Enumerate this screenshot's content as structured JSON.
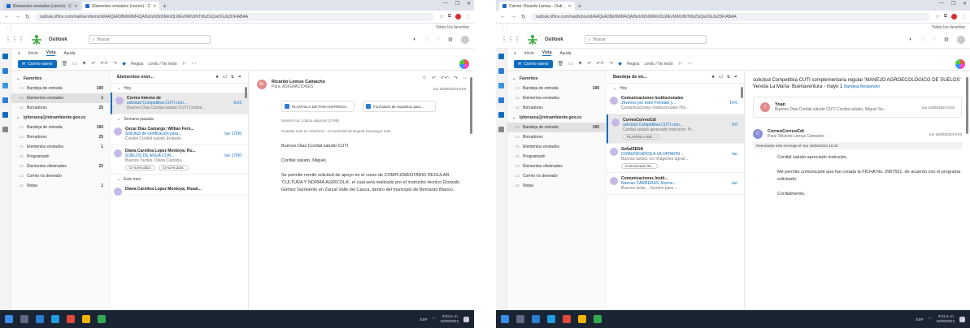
{
  "left": {
    "browser": {
      "tabs": [
        "Elementos enviados (correo) - C",
        "Elementos enviados (correo) - C"
      ],
      "url": "outlook.office.com/mail/sentitems/id/AAQkADBkNWM4ZjAtNzIxNS00MmI3LWEzNWUtNTMxZGQwOGJkZDFiABAA",
      "bookmark_right": "Todos los favoritos"
    },
    "app_name": "Outlook",
    "search_placeholder": "Buscar",
    "ribbon_tabs": [
      "Inicio",
      "Vista",
      "Ayuda"
    ],
    "new_mail_label": "Correo nuevo",
    "ribbon_extra": [
      "Reglas",
      "Leído / No leído"
    ],
    "folders": [
      {
        "name": "Favoritos",
        "count": "",
        "type": "header"
      },
      {
        "name": "Bandeja de entrada",
        "count": "190",
        "type": "item"
      },
      {
        "name": "Elementos enviados",
        "count": "1",
        "type": "item",
        "selected": true
      },
      {
        "name": "Borradores",
        "count": "25",
        "type": "item"
      },
      {
        "name": "lpfonseca@minambiente.gov.co",
        "count": "",
        "type": "header"
      },
      {
        "name": "Bandeja de entrada",
        "count": "190",
        "type": "item"
      },
      {
        "name": "Borradores",
        "count": "25",
        "type": "item"
      },
      {
        "name": "Elementos enviados",
        "count": "1",
        "type": "item"
      },
      {
        "name": "Programado",
        "count": "",
        "type": "item"
      },
      {
        "name": "Elementos eliminados",
        "count": "22",
        "type": "item"
      },
      {
        "name": "Correo no deseado",
        "count": "",
        "type": "item"
      },
      {
        "name": "Notas",
        "count": "1",
        "type": "item"
      }
    ],
    "list_title": "Elementos envi...",
    "groups": [
      "Hoy",
      "Semana pasada",
      "Este mes"
    ],
    "messages": [
      {
        "from": "Correo Interno de",
        "subject": "solicitud Competitiva CUTI com...",
        "time": "9:03",
        "preview": "Buenos Días Cordial saludo CUTI Cordial...",
        "selected": true
      },
      {
        "from": "Oscar Dias Camargo; Willian Fern...",
        "subject": "Solicitud de certificación para...",
        "time": "lun 17/06",
        "preview": "Cordial Cordial saludo Enviado",
        "selected": false
      },
      {
        "from": "Diana Carolina Lopez Montoya; Ru...",
        "subject": "SUELOS DE AGUA CON...",
        "time": "lun 17/06",
        "preview": "Buenos Tardes, Diana Carolina...",
        "selected": false,
        "chips": [
          "CI-sol-8.ddoc",
          "CI-sol-8.ddoc"
        ]
      },
      {
        "from": "Diana Carolina Lopez Montoya; Rosal...",
        "subject": "",
        "time": "",
        "preview": "",
        "selected": false
      }
    ],
    "reading": {
      "from": "Ricardo Lemus Camacho",
      "to": "Para: ASIGNACIONES",
      "date": "lun 18/06/2024 9:03",
      "attachments": [
        "PLANTILLA DE PARA ENTREGA...",
        "Formulario de requisitos para..."
      ],
      "note": "Mostrar los 2 datos adjuntos (2 MB)",
      "note2": "Guardar todo en OneDrive - Universidad de Bogotá   Descargar todo",
      "body": [
        "Buenos Dias  Cordial saludo CUTI",
        "Cordial saludo, Miguel,",
        "Se permite remitir solicitud de apoyo en el curso de COMPLEMENTARIO REGULAR 'CULTURA Y NORMA AGRÍCOLA', el cual será realizado por el instructor técnico Gonzalo Gómez Sarmiento en Zarzal Valle del Cauca, dentro del municipio de Bernardo Blanco."
      ]
    },
    "taskbar": {
      "time": "9:03 a. m.",
      "date": "18/06/2024",
      "lang": "ESP"
    }
  },
  "right": {
    "browser": {
      "tabs": [
        "Correo: Ricardo Lemus - Outl..."
      ],
      "url": "outlook.office.com/mail/inbox/id/AAQkADBkNWM4ZjAtNzIxNS00MmI3LWEzNWUtNTMxZGQwOGJkZDFiABAA",
      "bookmark_right": "Todos los favoritos"
    },
    "app_name": "Outlook",
    "search_placeholder": "Buscar",
    "ribbon_tabs": [
      "Inicio",
      "Vista",
      "Ayuda"
    ],
    "new_mail_label": "Correo nuevo",
    "ribbon_extra": [
      "Reglas",
      "Leído / No leído"
    ],
    "folders": [
      {
        "name": "Favoritos",
        "count": "",
        "type": "header"
      },
      {
        "name": "Bandeja de entrada",
        "count": "190",
        "type": "item"
      },
      {
        "name": "Elementos enviados",
        "count": "",
        "type": "item"
      },
      {
        "name": "Borradores",
        "count": "",
        "type": "item"
      },
      {
        "name": "lpfonseca@minambiente.gov.co",
        "count": "",
        "type": "header"
      },
      {
        "name": "Bandeja de entrada",
        "count": "190",
        "type": "item",
        "selected": true
      },
      {
        "name": "Borradores",
        "count": "",
        "type": "item"
      },
      {
        "name": "Elementos enviados",
        "count": "",
        "type": "item"
      },
      {
        "name": "Programado",
        "count": "",
        "type": "item"
      },
      {
        "name": "Elementos eliminados",
        "count": "",
        "type": "item"
      },
      {
        "name": "Correo no deseado",
        "count": "",
        "type": "item"
      },
      {
        "name": "Notas",
        "count": "",
        "type": "item"
      }
    ],
    "list_title": "Bandeja de en...",
    "groups": [
      "Hoy"
    ],
    "messages": [
      {
        "from": "Comunicaciones Institucionales",
        "subject": "Jóvenes por ésto! Fórmate y...",
        "time": "14:0",
        "preview": "Comunicaciones Institucionales Hol...",
        "selected": false
      },
      {
        "from": "CorreoCorreoCdi",
        "subject": "solicitud Competitiva CUTI com...",
        "time": "9:0",
        "preview": "Cordial saludo apreciado instructor, Pr...",
        "selected": true,
        "chips": [
          "PLANTILLA DE..."
        ]
      },
      {
        "from": "SeñalSENA",
        "subject": "COMUNICADOS A LA OPINION ...",
        "time": "lun",
        "preview": "Buenas tardes. En imágenes agrad...",
        "selected": false,
        "chips": [
          "Comunicado 05..."
        ]
      },
      {
        "from": "Comunicaciones Instit...",
        "subject": "Nuevas CARRERAS Jóvene...",
        "time": "lun",
        "preview": "Buenos tarde... Gestión para ...",
        "selected": false
      }
    ],
    "reading": {
      "subject": "solicitud Competitiva CUTI complementaria regular 'MANEJO AGROECOLÓGICO DE SUELOS' Vereda La María- Buenaventura - mayo 1",
      "subject_tags": "Bandeja  Responder",
      "thread1_from": "Yoan",
      "thread1_preview": "Buenos Dias Cordial saludo CUTI Cordial saludo, Miguel Se...",
      "thread1_date": "lun 10/06/2024 9:03",
      "thread2_from": "CorreoCorreoCdi",
      "thread2_to": "Para: Ricardo Lemus Camacho",
      "thread2_date": "lun 18/06/2024 9:03",
      "info": "Reenviaste este mensaje el mar 18/06/2024 16:33",
      "body": [
        "Cordial saludo apreciado instructor,",
        "Me permito comunicarle que fue creada la FICHA No. 2987551, de acuerdo con el programa solicitado.",
        "Cordialmente,"
      ]
    },
    "taskbar": {
      "time": "9:22 a. m.",
      "date": "18/06/2024",
      "lang": "ESP"
    }
  },
  "colors": {
    "accent": "#0f6cbd",
    "taskbar": "#1b2433",
    "selected": "#e9e9e9"
  }
}
